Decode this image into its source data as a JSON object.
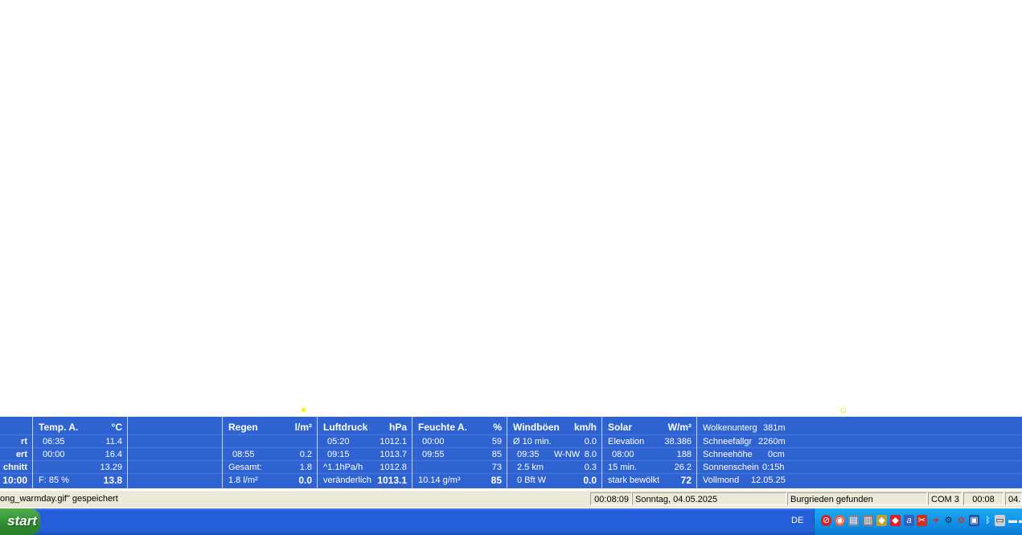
{
  "weather": {
    "partial": {
      "rows": [
        "rt",
        "ert",
        "chnitt",
        "10:00"
      ]
    },
    "temp": {
      "header_label": "Temp. A.",
      "header_unit": "°C",
      "rows": [
        {
          "left": "06:35",
          "right": "11.4"
        },
        {
          "left": "00:00",
          "right": "16.4"
        },
        {
          "left": "",
          "right": "13.29"
        },
        {
          "left": "F: 85 %",
          "right": "13.8"
        }
      ]
    },
    "regen": {
      "header_label": "Regen",
      "header_unit": "l/m²",
      "rows": [
        {
          "left": "",
          "right": ""
        },
        {
          "left": "08:55",
          "right": "0.2"
        },
        {
          "left": "Gesamt:",
          "right": "1.8"
        },
        {
          "left": "1.8 l/m²",
          "right": "0.0"
        }
      ]
    },
    "luftdruck": {
      "header_label": "Luftdruck",
      "header_unit": "hPa",
      "rows": [
        {
          "left": "05:20",
          "right": "1012.1"
        },
        {
          "left": "09:15",
          "right": "1013.7"
        },
        {
          "left": "^1.1hPa/h",
          "right": "1012.8"
        },
        {
          "left": "veränderlich",
          "right": "1013.1"
        }
      ]
    },
    "feuchte": {
      "header_label": "Feuchte A.",
      "header_unit": "%",
      "rows": [
        {
          "left": "00:00",
          "right": "59"
        },
        {
          "left": "09:55",
          "right": "85"
        },
        {
          "left": "",
          "right": "73"
        },
        {
          "left": "10.14 g/m³",
          "right": "85"
        }
      ]
    },
    "wind": {
      "header_label": "Windböen",
      "header_unit": "km/h",
      "rows": [
        {
          "left": "Ø 10 min.",
          "mid": "",
          "right": "0.0"
        },
        {
          "left": "09:35",
          "mid": "W-NW",
          "right": "8.0"
        },
        {
          "left": "2.5 km",
          "mid": "",
          "right": "0.3"
        },
        {
          "left": "0 Bft W",
          "mid": "",
          "right": "0.0"
        }
      ]
    },
    "solar": {
      "header_label": "Solar",
      "header_unit": "W/m²",
      "rows": [
        {
          "left": "Elevation",
          "right": "38.386"
        },
        {
          "left": "08:00",
          "right": "188"
        },
        {
          "left": "15 min.",
          "right": "26.2"
        },
        {
          "left": "stark bewölkt",
          "right": "72"
        }
      ]
    },
    "info": {
      "rows": [
        {
          "left": "Wolkenunterg",
          "right": "381m"
        },
        {
          "left": "Schneefallgr",
          "right": "2260m"
        },
        {
          "left": "Schneehöhe",
          "right": "0cm"
        },
        {
          "left": "Sonnenschein",
          "right": "0:15h"
        },
        {
          "left": "Vollmond",
          "right": "12.05.25"
        }
      ]
    }
  },
  "status_bar": {
    "message": "ong_warmday.gif\"  gespeichert",
    "elapsed": "00:08:09",
    "date": "Sonntag, 04.05.2025",
    "location": "Burgrieden gefunden",
    "port": "COM 3",
    "time": "00:08",
    "partial": "04."
  },
  "taskbar": {
    "start_label": "start",
    "language": "DE",
    "tray_icons": [
      "stop-icon",
      "disc-icon",
      "network-icon",
      "printer-icon",
      "shield-icon",
      "red-app-icon",
      "a-icon",
      "tool-icon",
      "red-arrow-icon",
      "gear-icon",
      "pin-icon",
      "security-icon",
      "bluetooth-icon",
      "window-icon",
      "monitor-icon",
      "monitor-partial-icon"
    ]
  }
}
